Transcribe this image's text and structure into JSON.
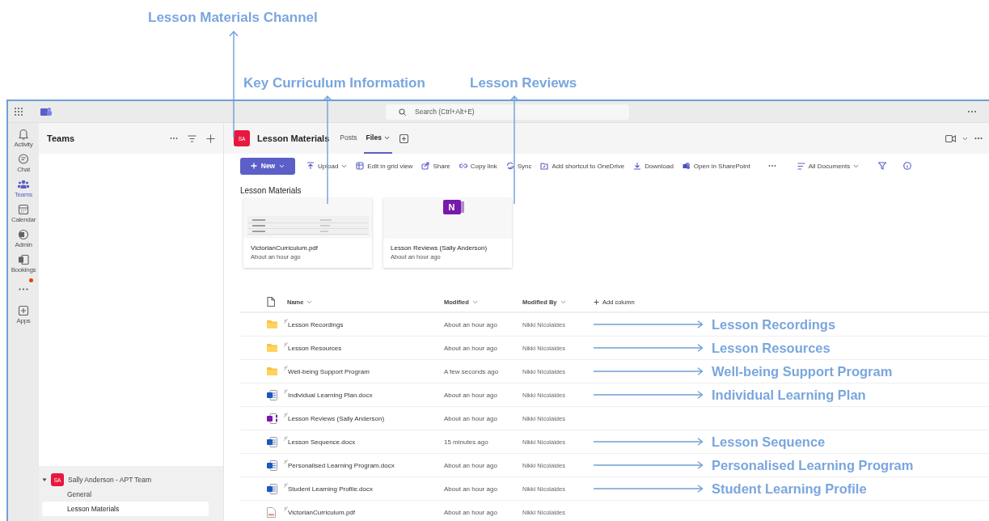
{
  "callouts": [
    {
      "text": "Lesson Materials Channel"
    },
    {
      "text": "Key Curriculum Information"
    },
    {
      "text": "Lesson Reviews"
    }
  ],
  "title_bar": {
    "search_placeholder": "Search (Ctrl+Alt+E)"
  },
  "rail": [
    {
      "label": "Activity",
      "selected": false,
      "notification": false
    },
    {
      "label": "Chat",
      "selected": false,
      "notification": false
    },
    {
      "label": "Teams",
      "selected": true,
      "notification": false
    },
    {
      "label": "Calendar",
      "selected": false,
      "notification": false
    },
    {
      "label": "Admin",
      "selected": false,
      "notification": false
    },
    {
      "label": "Bookings",
      "selected": false,
      "notification": false
    },
    {
      "kind": "more",
      "selected": false,
      "notification": true
    },
    {
      "label": "Apps",
      "selected": false,
      "notification": false
    }
  ],
  "teams_panel": {
    "title": "Teams",
    "teams": [
      {
        "avatar": "SA",
        "name": "Sally Anderson - APT Team",
        "expanded": true,
        "channels": [
          {
            "name": "General",
            "selected": false
          },
          {
            "name": "Lesson Materials",
            "selected": true
          }
        ]
      }
    ]
  },
  "channel_header": {
    "avatar": "SA",
    "title": "Lesson Materials",
    "tabs": [
      {
        "label": "Posts",
        "selected": false,
        "dropdown": false
      },
      {
        "label": "Files",
        "selected": true,
        "dropdown": true
      }
    ]
  },
  "toolbar": {
    "new_button": "New",
    "actions": [
      {
        "label": "Upload",
        "dropdown": true
      },
      {
        "label": "Edit in grid view",
        "dropdown": false
      },
      {
        "label": "Share",
        "dropdown": false
      },
      {
        "label": "Copy link",
        "dropdown": false
      },
      {
        "label": "Sync",
        "dropdown": false
      },
      {
        "label": "Add shortcut to OneDrive",
        "dropdown": false
      },
      {
        "label": "Download",
        "dropdown": false
      },
      {
        "label": "Open in SharePoint",
        "dropdown": false
      }
    ],
    "view": "All Documents"
  },
  "library": {
    "title": "Lesson Materials",
    "cards": [
      {
        "kind": "pdf",
        "name": "VictorianCurriculum.pdf",
        "time": "About an hour ago"
      },
      {
        "kind": "onenote",
        "icon_text": "N",
        "name": "Lesson Reviews (Sally Anderson)",
        "time": "About an hour ago"
      }
    ],
    "columns": [
      "Name",
      "Modified",
      "Modified By"
    ],
    "add_column": "Add column",
    "rows": [
      {
        "kind": "folder",
        "name": "Lesson Recordings",
        "modified": "About an hour ago",
        "modified_by": "Nikki Nicolaides",
        "callout": "Lesson Recordings"
      },
      {
        "kind": "folder",
        "name": "Lesson Resources",
        "modified": "About an hour ago",
        "modified_by": "Nikki Nicolaides",
        "callout": "Lesson Resources"
      },
      {
        "kind": "folder",
        "name": "Well-being Support Program",
        "modified": "A few seconds ago",
        "modified_by": "Nikki Nicolaides",
        "callout": "Well-being Support Program"
      },
      {
        "kind": "word",
        "name": "Individual Learning Plan.docx",
        "modified": "About an hour ago",
        "modified_by": "Nikki Nicolaides",
        "callout": "Individual Learning Plan"
      },
      {
        "kind": "onenote",
        "name": "Lesson Reviews (Sally Anderson)",
        "modified": "About an hour ago",
        "modified_by": "Nikki Nicolaides"
      },
      {
        "kind": "word",
        "name": "Lesson Sequence.docx",
        "modified": "15 minutes ago",
        "modified_by": "Nikki Nicolaides",
        "callout": "Lesson Sequence"
      },
      {
        "kind": "word",
        "name": "Personalised Learning Program.docx",
        "modified": "About an hour ago",
        "modified_by": "Nikki Nicolaides",
        "callout": "Personalised Learning Program"
      },
      {
        "kind": "word",
        "name": "Student Learning Profile.docx",
        "modified": "About an hour ago",
        "modified_by": "Nikki Nicolaides",
        "callout": "Student Learning Profile"
      },
      {
        "kind": "pdf",
        "name": "VictorianCurriculum.pdf",
        "modified": "About an hour ago",
        "modified_by": "Nikki Nicolaides"
      }
    ]
  }
}
